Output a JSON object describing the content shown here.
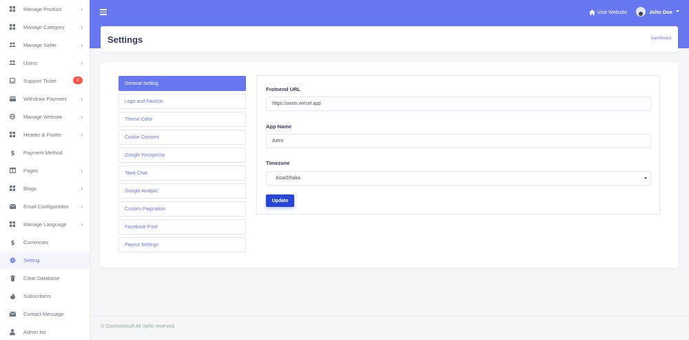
{
  "sidebar": {
    "items": [
      {
        "label": "Manage Product",
        "icon": "grid-icon",
        "chevron": true
      },
      {
        "label": "Manage Category",
        "icon": "grid-icon",
        "chevron": true
      },
      {
        "label": "Manage Seller",
        "icon": "users-icon",
        "chevron": true
      },
      {
        "label": "Users",
        "icon": "users-icon",
        "chevron": true
      },
      {
        "label": "Support Ticket",
        "icon": "inbox-icon",
        "badge": "0"
      },
      {
        "label": "Withdraw Payment",
        "icon": "card-icon",
        "chevron": true
      },
      {
        "label": "Manage Website",
        "icon": "globe-icon",
        "chevron": true
      },
      {
        "label": "Header & Footer",
        "icon": "grid-icon",
        "chevron": true
      },
      {
        "label": "Payment Method",
        "icon": "dollar-icon"
      },
      {
        "label": "Pages",
        "icon": "columns-icon",
        "chevron": true
      },
      {
        "label": "Blogs",
        "icon": "grid-icon",
        "chevron": true
      },
      {
        "label": "Email Configuration",
        "icon": "envelope-icon",
        "chevron": true
      },
      {
        "label": "Manage Language",
        "icon": "grid-icon",
        "chevron": true
      },
      {
        "label": "Currencies",
        "icon": "dollar-icon"
      },
      {
        "label": "Setting",
        "icon": "gear-icon",
        "active": true
      },
      {
        "label": "Clear Database",
        "icon": "trash-icon"
      },
      {
        "label": "Subscribers",
        "icon": "fire-icon"
      },
      {
        "label": "Contact Message",
        "icon": "envelope-icon"
      },
      {
        "label": "Admin list",
        "icon": "user-icon"
      }
    ]
  },
  "topbar": {
    "visit_label": "Visit Website",
    "user_name": "John Doe",
    "accent": "#6777ef"
  },
  "header": {
    "title": "Settings",
    "breadcrumb": "Dashboard"
  },
  "settings_tabs": [
    {
      "label": "General Setting",
      "active": true
    },
    {
      "label": "Logo and Favicon"
    },
    {
      "label": "Theme Color"
    },
    {
      "label": "Cookie Consent"
    },
    {
      "label": "Google Recaptcha"
    },
    {
      "label": "Tawk Chat"
    },
    {
      "label": "Google Analytic"
    },
    {
      "label": "Custom Pagination"
    },
    {
      "label": "Facebook Pixel"
    },
    {
      "label": "Payout Settings"
    }
  ],
  "form": {
    "frontend_url_label": "Frotnend URL",
    "frontend_url_value": "https://axtro.vercel.app",
    "app_name_label": "App Name",
    "app_name_value": "Axtro",
    "timezone_label": "Timezone",
    "timezone_value": "Asia/Dhaka",
    "update_label": "Update"
  },
  "footer": {
    "copyright": "© Quomodosoft All rights reserved"
  }
}
